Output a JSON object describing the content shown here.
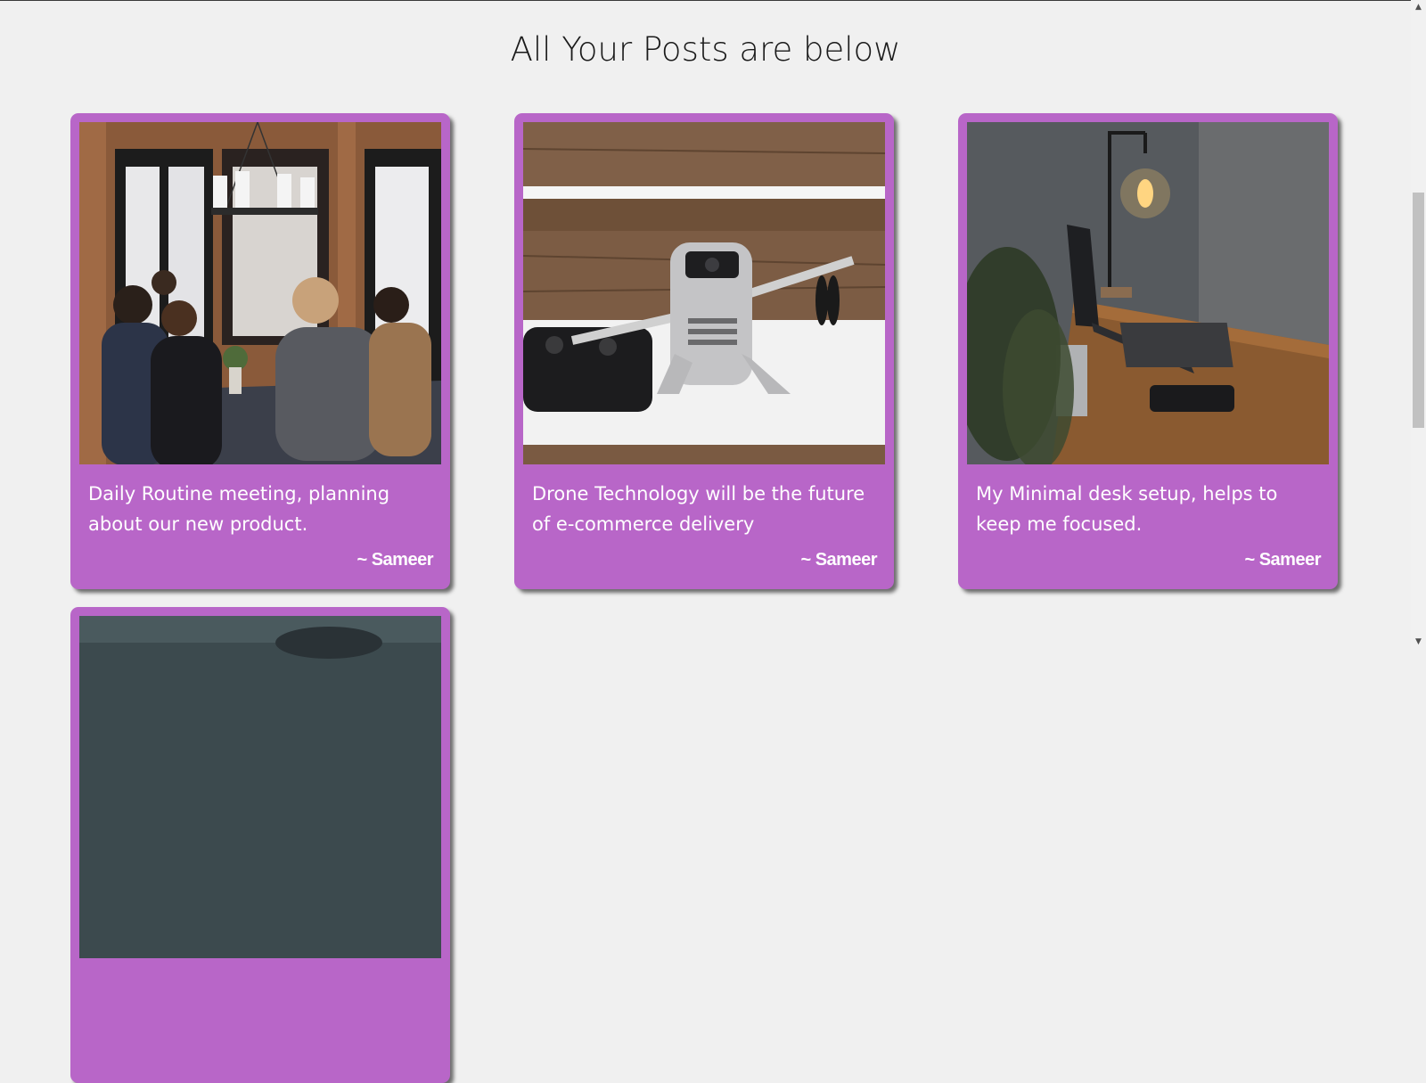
{
  "page": {
    "title": "All Your Posts are below"
  },
  "posts": [
    {
      "caption": "Daily Routine meeting, planning about our new product.",
      "author": "~ Sameer",
      "image": "team-meeting-photo"
    },
    {
      "caption": "Drone Technology will be the future of e-commerce delivery",
      "author": "~ Sameer",
      "image": "drone-on-snow-photo"
    },
    {
      "caption": "My Minimal desk setup, helps to keep me focused.",
      "author": "~ Sameer",
      "image": "desk-setup-photo"
    },
    {
      "caption": "",
      "author": "",
      "image": "partial-photo"
    }
  ],
  "colors": {
    "background": "#f0f0f0",
    "card": "#b866c8",
    "card_text": "#ffffff",
    "title_text": "#1a1a1a"
  },
  "scrollbar": {
    "up_icon": "chevron-up-icon",
    "down_icon": "chevron-down-icon"
  }
}
